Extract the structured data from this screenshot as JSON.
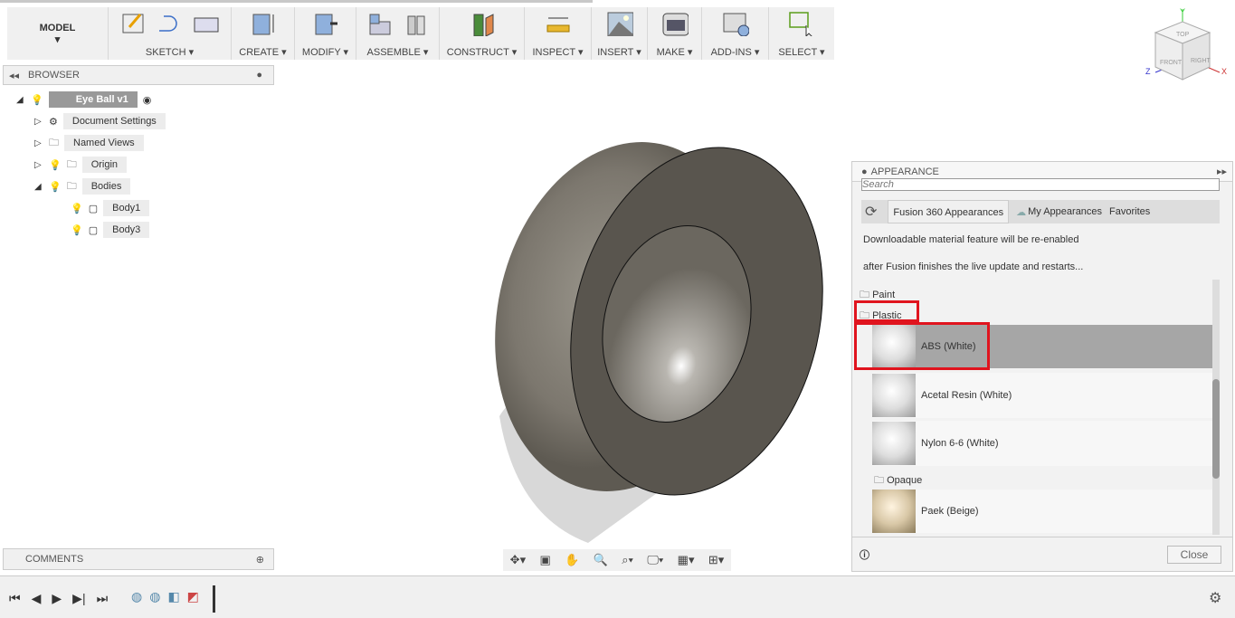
{
  "toolbar": {
    "workspace": "MODEL",
    "groups": [
      "SKETCH",
      "CREATE",
      "MODIFY",
      "ASSEMBLE",
      "CONSTRUCT",
      "INSPECT",
      "INSERT",
      "MAKE",
      "ADD-INS",
      "SELECT"
    ]
  },
  "browser": {
    "title": "BROWSER",
    "root": "Eye Ball v1",
    "items": [
      {
        "label": "Document Settings"
      },
      {
        "label": "Named Views"
      },
      {
        "label": "Origin"
      },
      {
        "label": "Bodies"
      },
      {
        "label": "Body1"
      },
      {
        "label": "Body3"
      }
    ]
  },
  "comments": {
    "title": "COMMENTS"
  },
  "viewcube": {
    "top": "TOP",
    "front": "FRONT",
    "right": "RIGHT",
    "x": "X",
    "y": "Y",
    "z": "Z"
  },
  "appearance": {
    "title": "APPEARANCE",
    "search_placeholder": "Search",
    "tabs": [
      "Fusion 360 Appearances",
      "My Appearances",
      "Favorites"
    ],
    "notice1": "Downloadable material feature will be re-enabled",
    "notice2": "after Fusion finishes the live update and restarts...",
    "folders": [
      "Paint",
      "Plastic",
      "Opaque"
    ],
    "materials": [
      "ABS (White)",
      "Acetal Resin (White)",
      "Nylon 6-6 (White)",
      "Paek (Beige)"
    ],
    "close": "Close",
    "highlight_color": "#e0141e"
  }
}
